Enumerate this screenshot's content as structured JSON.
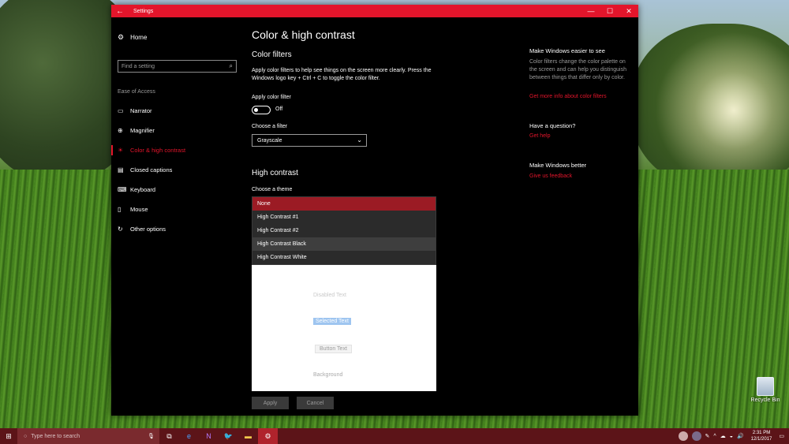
{
  "window": {
    "title": "Settings",
    "back": "←",
    "minimize": "—",
    "maximize": "☐",
    "close": "✕"
  },
  "sidebar": {
    "home_label": "Home",
    "search_placeholder": "Find a setting",
    "section_label": "Ease of Access",
    "items": [
      {
        "label": "Narrator",
        "icon": "narrator-icon",
        "glyph": "▭"
      },
      {
        "label": "Magnifier",
        "icon": "magnifier-icon",
        "glyph": "⊕"
      },
      {
        "label": "Color & high contrast",
        "icon": "contrast-icon",
        "glyph": "☀"
      },
      {
        "label": "Closed captions",
        "icon": "captions-icon",
        "glyph": "▤"
      },
      {
        "label": "Keyboard",
        "icon": "keyboard-icon",
        "glyph": "⌨"
      },
      {
        "label": "Mouse",
        "icon": "mouse-icon",
        "glyph": "▯"
      },
      {
        "label": "Other options",
        "icon": "options-icon",
        "glyph": "↻"
      }
    ],
    "active_index": 2
  },
  "main": {
    "page_title": "Color & high contrast",
    "color_filters": {
      "heading": "Color filters",
      "description": "Apply color filters to help see things on the screen more clearly. Press the Windows logo key + Ctrl + C to toggle the color filter.",
      "apply_label": "Apply color filter",
      "toggle_state": "Off",
      "choose_label": "Choose a filter",
      "selected_filter": "Grayscale"
    },
    "high_contrast": {
      "heading": "High contrast",
      "choose_theme_label": "Choose a theme",
      "theme_options": [
        "None",
        "High Contrast #1",
        "High Contrast #2",
        "High Contrast Black",
        "High Contrast White"
      ],
      "selected_option": "None",
      "hovered_option": "High Contrast Black",
      "preview": {
        "disabled_text": "Disabled Text",
        "selected_text": "Selected Text",
        "button_text": "Button Text",
        "background": "Background"
      },
      "apply_button": "Apply",
      "cancel_button": "Cancel"
    }
  },
  "aside": {
    "easier_heading": "Make Windows easier to see",
    "easier_text": "Color filters change the color palette on the screen and can help you distinguish between things that differ only by color.",
    "easier_link": "Get more info about color filters",
    "question_heading": "Have a question?",
    "question_link": "Get help",
    "better_heading": "Make Windows better",
    "better_link": "Give us feedback"
  },
  "desktop": {
    "recycle_bin_label": "Recycle Bin"
  },
  "taskbar": {
    "search_placeholder": "Type here to search",
    "time": "2:31 PM",
    "date": "12/1/2017"
  },
  "colors": {
    "accent": "#e3152b",
    "taskbar": "#5c1418",
    "window_bg": "#000000"
  }
}
